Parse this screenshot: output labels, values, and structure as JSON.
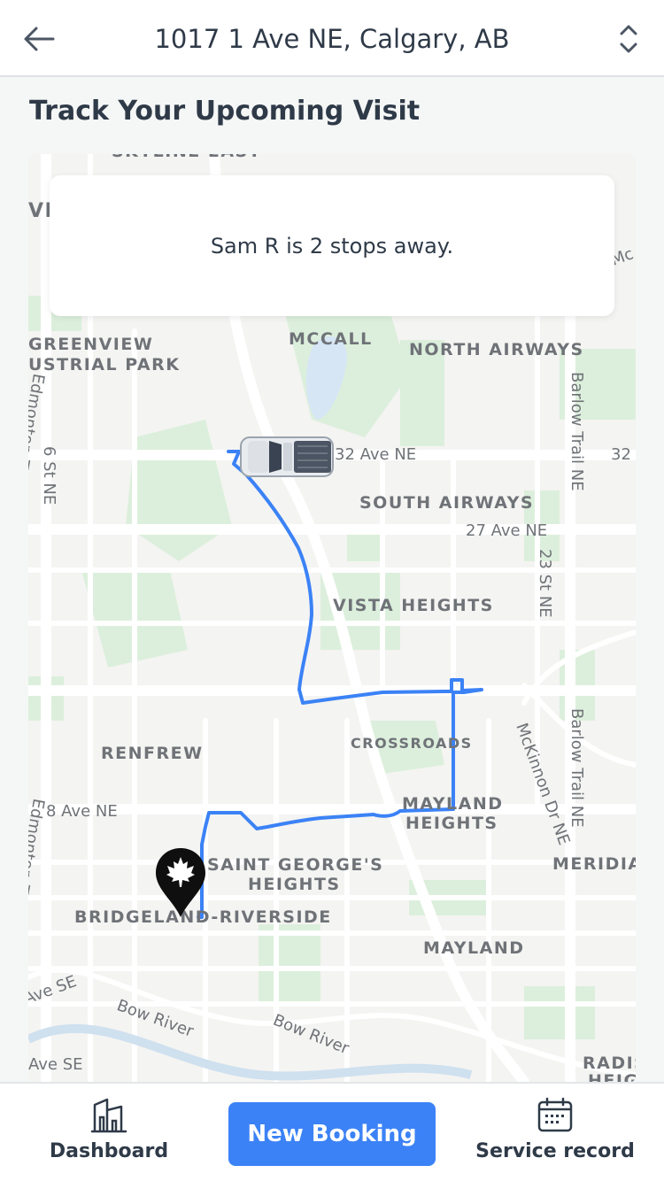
{
  "header": {
    "title": "1017 1 Ave NE, Calgary, AB",
    "back_icon": "arrow-left-icon",
    "switch_icon": "chevron-up-down-icon"
  },
  "section": {
    "title": "Track Your Upcoming Visit"
  },
  "map": {
    "status_message": "Sam R is 2 stops away.",
    "route_color": "#3b82f6",
    "labels": {
      "skyline_east": "SKYLINE EAST",
      "vi": "VI",
      "mc": "Mc",
      "greenview": "GREENVIEW",
      "industrial_park": "USTRIAL PARK",
      "mccall": "MCCALL",
      "north_airways": "NORTH AIRWAYS",
      "south_airways": "SOUTH AIRWAYS",
      "vista_heights": "VISTA HEIGHTS",
      "crossroads": "CROSSROADS",
      "renfrew": "RENFREW",
      "mayland_heights_1": "MAYLAND",
      "mayland_heights_2": "HEIGHTS",
      "saint_georges_1": "SAINT GEORGE'S",
      "saint_georges_2": "HEIGHTS",
      "bridgeland": "BRIDGELAND-RIVERSIDE",
      "mayland": "MAYLAND",
      "meridian": "MERIDIA",
      "radisson_1": "RADIS",
      "radisson_2": "HEIG"
    },
    "roads": {
      "ave_32_ne": "32 Ave NE",
      "ave_32_ne_right": "32",
      "ave_27_ne": "27 Ave NE",
      "ave_8_ne": "8 Ave NE",
      "st_6_ne": "6 St NE",
      "st_23_ne": "23 St NE",
      "barlow_trail_1": "Barlow Trail NE",
      "barlow_trail_2": "Barlow Trail NE",
      "mckinnon": "McKinnon Dr NE",
      "edmonton_trl": "Edmonton Trl",
      "edmonton_trl_2": "Edmonton Trl",
      "bow_river_1": "Bow River",
      "bow_river_2": "Bow River",
      "ave_se_1": "Ave SE",
      "ave_se_2": "Ave SE"
    },
    "truck_icon": "pickup-truck-icon",
    "destination_icon": "maple-leaf-pin-icon"
  },
  "bottom_nav": {
    "dashboard_label": "Dashboard",
    "dashboard_icon": "building-chart-icon",
    "new_booking_label": "New Booking",
    "service_record_label": "Service record",
    "service_record_icon": "calendar-icon"
  }
}
